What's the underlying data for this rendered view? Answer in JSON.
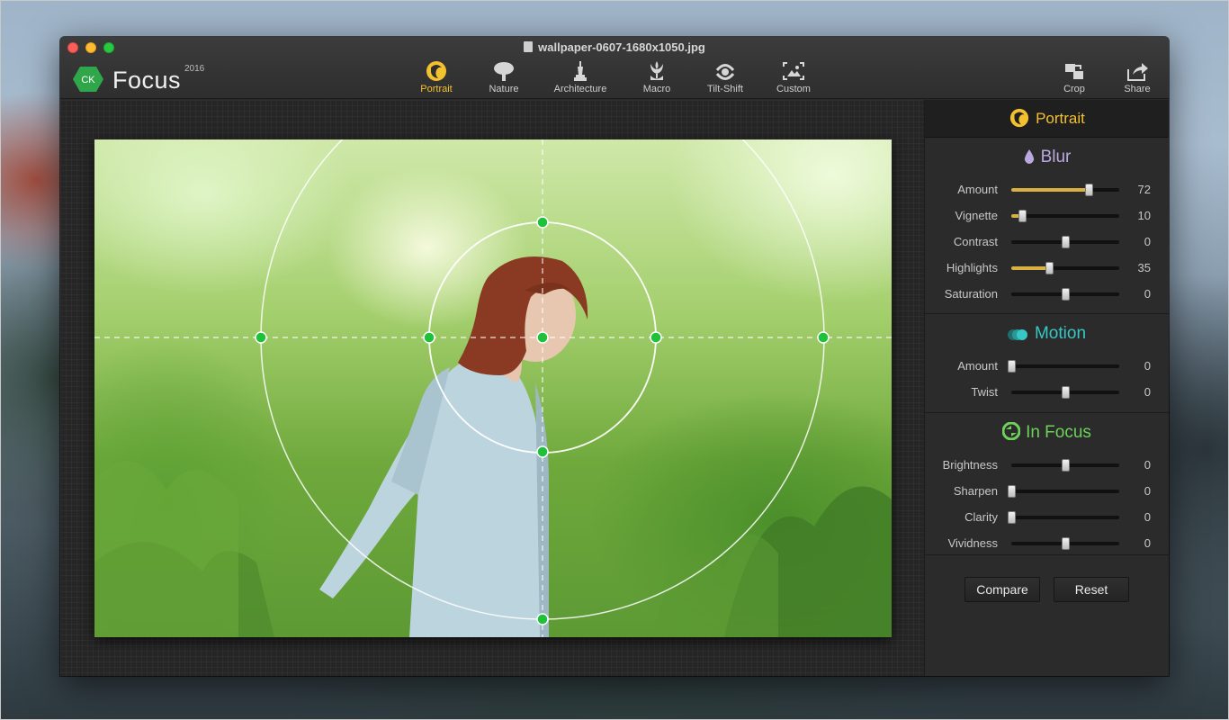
{
  "window": {
    "title": "wallpaper-0607-1680x1050.jpg"
  },
  "logo": {
    "badge": "CK",
    "name": "Focus",
    "year": "2016"
  },
  "toolbar": {
    "modes": [
      {
        "label": "Portrait",
        "icon": "portrait-icon",
        "active": true
      },
      {
        "label": "Nature",
        "icon": "tree-icon",
        "active": false
      },
      {
        "label": "Architecture",
        "icon": "statue-icon",
        "active": false
      },
      {
        "label": "Macro",
        "icon": "flower-icon",
        "active": false
      },
      {
        "label": "Tilt-Shift",
        "icon": "tilt-shift-icon",
        "active": false
      },
      {
        "label": "Custom",
        "icon": "custom-frame-icon",
        "active": false
      }
    ],
    "crop_label": "Crop",
    "share_label": "Share"
  },
  "panel": {
    "header": "Portrait",
    "blur": {
      "title": "Blur",
      "controls": [
        {
          "label": "Amount",
          "value": "72",
          "fraction": 0.72,
          "filled": true
        },
        {
          "label": "Vignette",
          "value": "10",
          "fraction": 0.1,
          "filled": true
        },
        {
          "label": "Contrast",
          "value": "0",
          "fraction": 0.5,
          "filled": false
        },
        {
          "label": "Highlights",
          "value": "35",
          "fraction": 0.35,
          "filled": true
        },
        {
          "label": "Saturation",
          "value": "0",
          "fraction": 0.5,
          "filled": false
        }
      ]
    },
    "motion": {
      "title": "Motion",
      "controls": [
        {
          "label": "Amount",
          "value": "0",
          "fraction": 0.0,
          "filled": false
        },
        {
          "label": "Twist",
          "value": "0",
          "fraction": 0.5,
          "filled": false
        }
      ]
    },
    "infocus": {
      "title": "In Focus",
      "controls": [
        {
          "label": "Brightness",
          "value": "0",
          "fraction": 0.5,
          "filled": false
        },
        {
          "label": "Sharpen",
          "value": "0",
          "fraction": 0.0,
          "filled": false
        },
        {
          "label": "Clarity",
          "value": "0",
          "fraction": 0.0,
          "filled": false
        },
        {
          "label": "Vividness",
          "value": "0",
          "fraction": 0.5,
          "filled": false
        }
      ]
    },
    "buttons": {
      "compare": "Compare",
      "reset": "Reset"
    }
  },
  "colors": {
    "accent": "#f3c12e",
    "blur_title": "#b9a9e0",
    "motion_title": "#37c7c4",
    "infocus_title": "#6dd15a",
    "handle": "#1fc13a"
  }
}
